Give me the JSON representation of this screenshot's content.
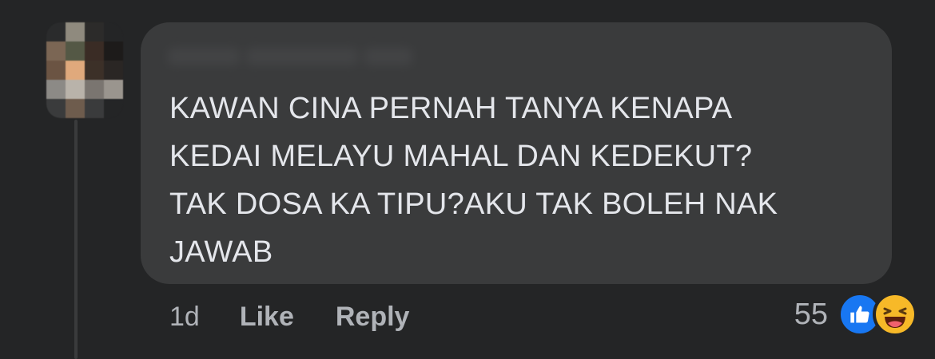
{
  "comment": {
    "text": "KAWAN CINA PERNAH TANYA KENAPA\nKEDAI MELAYU MAHAL DAN KEDEKUT?\nTAK DOSA KA TIPU?AKU TAK BOLEH NAK\nJAWAB",
    "timestamp": "1d",
    "like_label": "Like",
    "reply_label": "Reply",
    "reaction_count": "55",
    "reactions": [
      "like-icon",
      "haha-icon"
    ]
  },
  "colors": {
    "background": "#242526",
    "bubble": "#3a3b3c",
    "text": "#e4e6eb",
    "secondary_text": "#b0b3b8",
    "like_blue": "#1877f2",
    "haha_yellow": "#f7b928"
  }
}
